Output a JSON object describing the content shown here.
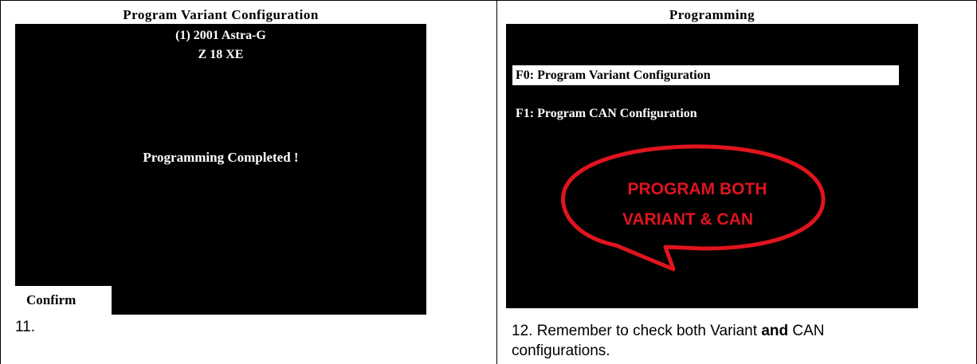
{
  "left_screen": {
    "title": "Program Variant Configuration",
    "line1": "(1) 2001 Astra-G",
    "line2": "Z 18 XE",
    "message": "Programming Completed !",
    "confirm_label": "Confirm"
  },
  "left_caption": "11.",
  "right_screen": {
    "title": "Programming",
    "menu": [
      {
        "label": "F0: Program Variant Configuration",
        "selected": true
      },
      {
        "label": "F1: Program CAN Configuration",
        "selected": false
      }
    ],
    "callout_line1": "PROGRAM BOTH",
    "callout_line2": "VARIANT & CAN",
    "callout_color": "#e0141e"
  },
  "right_caption": {
    "prefix": "12.  Remember to check both Variant ",
    "bold": "and",
    "suffix": " CAN",
    "line2": "configurations."
  }
}
